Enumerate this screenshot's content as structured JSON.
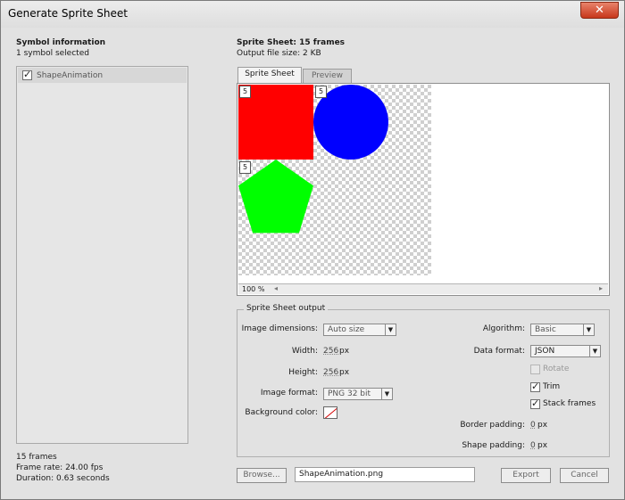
{
  "window": {
    "title": "Generate Sprite Sheet",
    "close_glyph": "✕"
  },
  "symbol_info": {
    "heading": "Symbol information",
    "selected": "1 symbol selected",
    "items": [
      {
        "label": "ShapeAnimation",
        "checked": true
      }
    ],
    "stats": {
      "frames": "15 frames",
      "frame_rate": "Frame rate: 24.00 fps",
      "duration": "Duration: 0.63 seconds"
    }
  },
  "sprite_sheet": {
    "heading": "Sprite Sheet: 15 frames",
    "file_size": "Output file size: 2 KB",
    "tabs": [
      {
        "label": "Sprite Sheet",
        "active": true
      },
      {
        "label": "Preview",
        "active": false
      }
    ],
    "frame_badge": "5",
    "zoom": "100 %",
    "shape_colors": {
      "square": "#ff0000",
      "circle": "#0000ff",
      "pentagon": "#00ff00"
    }
  },
  "output": {
    "group_label": "Sprite Sheet output",
    "image_dimensions": {
      "label": "Image dimensions:",
      "value": "Auto size"
    },
    "width": {
      "label": "Width:",
      "value": "256",
      "unit": "px"
    },
    "height": {
      "label": "Height:",
      "value": "256",
      "unit": "px"
    },
    "image_format": {
      "label": "Image format:",
      "value": "PNG 32 bit"
    },
    "background_color": {
      "label": "Background color:"
    },
    "algorithm": {
      "label": "Algorithm:",
      "value": "Basic"
    },
    "data_format": {
      "label": "Data format:",
      "value": "JSON"
    },
    "rotate": {
      "label": "Rotate",
      "checked": false,
      "enabled": false
    },
    "trim": {
      "label": "Trim",
      "checked": true
    },
    "stack_frames": {
      "label": "Stack frames",
      "checked": true
    },
    "border_padding": {
      "label": "Border padding:",
      "value": "0",
      "unit": "px"
    },
    "shape_padding": {
      "label": "Shape padding:",
      "value": "0",
      "unit": "px"
    }
  },
  "footer": {
    "browse_label": "Browse...",
    "filename": "ShapeAnimation.png",
    "export_label": "Export",
    "cancel_label": "Cancel"
  }
}
